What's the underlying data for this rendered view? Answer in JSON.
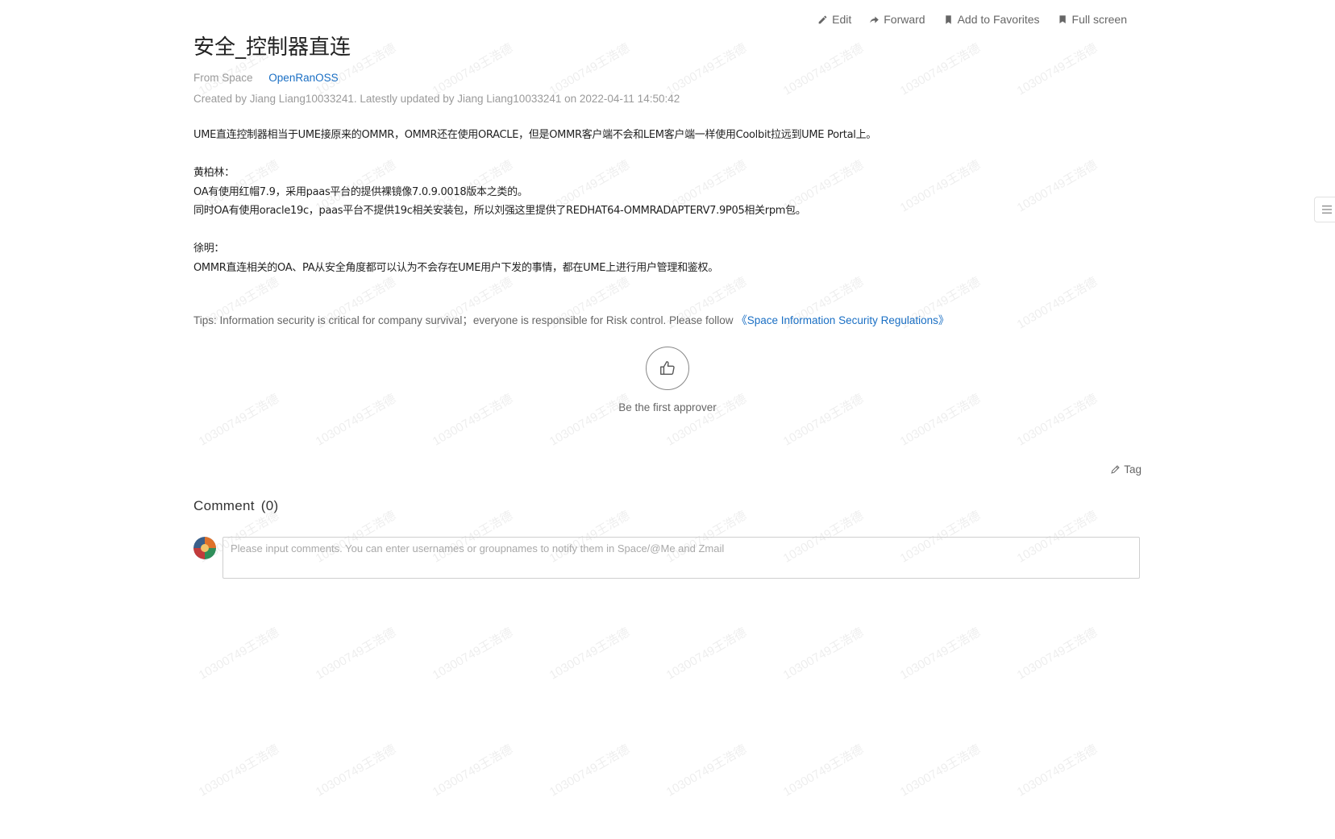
{
  "watermark_text": "10300749王浩德",
  "toolbar": {
    "edit": "Edit",
    "forward": "Forward",
    "favorites": "Add to Favorites",
    "fullscreen": "Full screen"
  },
  "page": {
    "title": "安全_控制器直连",
    "from_space_label": "From Space",
    "space_name": "OpenRanOSS",
    "meta": "Created by Jiang Liang10033241. Latestly updated by Jiang Liang10033241 on 2022-04-11 14:50:42"
  },
  "body": {
    "line1": "UME直连控制器相当于UME接原来的OMMR，OMMR还在使用ORACLE，但是OMMR客户端不会和LEM客户端一样使用Coolbit拉远到UME Portal上。",
    "line2": "黄柏林：",
    "line3": "OA有使用红帽7.9，采用paas平台的提供裸镜像7.0.9.0018版本之类的。",
    "line4": "同时OA有使用oracle19c，paas平台不提供19c相关安装包，所以刘强这里提供了REDHAT64-OMMRADAPTERV7.9P05相关rpm包。",
    "line5": "徐明：",
    "line6": "OMMR直连相关的OA、PA从安全角度都可以认为不会存在UME用户下发的事情，都在UME上进行用户管理和鉴权。"
  },
  "tips": {
    "text": "Tips: Information security is critical for company survival；everyone is responsible for Risk control. Please follow ",
    "link": "《Space Information Security Regulations》"
  },
  "like": {
    "text": "Be the first approver"
  },
  "tag_label": "Tag",
  "comments": {
    "title": "Comment",
    "count": "(0)",
    "placeholder": "Please input comments. You can enter usernames or groupnames to notify them in Space/@Me and Zmail"
  }
}
